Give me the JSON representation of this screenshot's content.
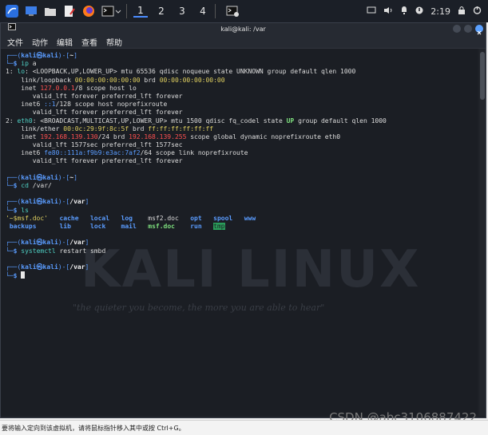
{
  "taskbar": {
    "workspaces": [
      "1",
      "2",
      "3",
      "4"
    ],
    "clock": "2:19"
  },
  "window": {
    "title": "kali@kali: /var",
    "menu": [
      "文件",
      "动作",
      "编辑",
      "查看",
      "帮助"
    ]
  },
  "terminal": {
    "watermark": "KALI LINUX",
    "quote": "\"the quieter you become, the more you are able to hear\"",
    "prompt_user": "kali",
    "prompt_host": "kali",
    "lines": [
      "┌──(kali㉿kali)-[~]",
      "└─$ ip a",
      "1: lo: <LOOPBACK,UP,LOWER_UP> mtu 65536 qdisc noqueue state UNKNOWN group default qlen 1000",
      "    link/loopback 00:00:00:00:00:00 brd 00:00:00:00:00:00",
      "    inet 127.0.0.1/8 scope host lo",
      "       valid_lft forever preferred_lft forever",
      "    inet6 ::1/128 scope host noprefixroute",
      "       valid_lft forever preferred_lft forever",
      "2: eth0: <BROADCAST,MULTICAST,UP,LOWER_UP> mtu 1500 qdisc fq_codel state UP group default qlen 1000",
      "    link/ether 00:0c:29:9f:8c:5f brd ff:ff:ff:ff:ff:ff",
      "    inet 192.168.139.130/24 brd 192.168.139.255 scope global dynamic noprefixroute eth0",
      "       valid_lft 1577sec preferred_lft 1577sec",
      "    inet6 fe80::111a:f9b9:e3ac:7af2/64 scope link noprefixroute",
      "       valid_lft forever preferred_lft forever",
      "",
      "┌──(kali㉿kali)-[~]",
      "└─$ cd /var/",
      "",
      "┌──(kali㉿kali)-[/var]",
      "└─$ ls",
      "'~$msf.doc'   cache   local   log    msf2.doc   opt   spool   www",
      " backups      lib     lock    mail   msf.doc    run   tmp",
      "",
      "┌──(kali㉿kali)-[/var]",
      "└─$ systemctl restart smbd",
      "",
      "┌──(kali㉿kali)-[/var]",
      "└─$ "
    ]
  },
  "host_status": "要将输入定向到该虚拟机，请将鼠标指针移入其中或按 Ctrl+G。",
  "watermark_csdn": "CSDN @abc3106887422"
}
